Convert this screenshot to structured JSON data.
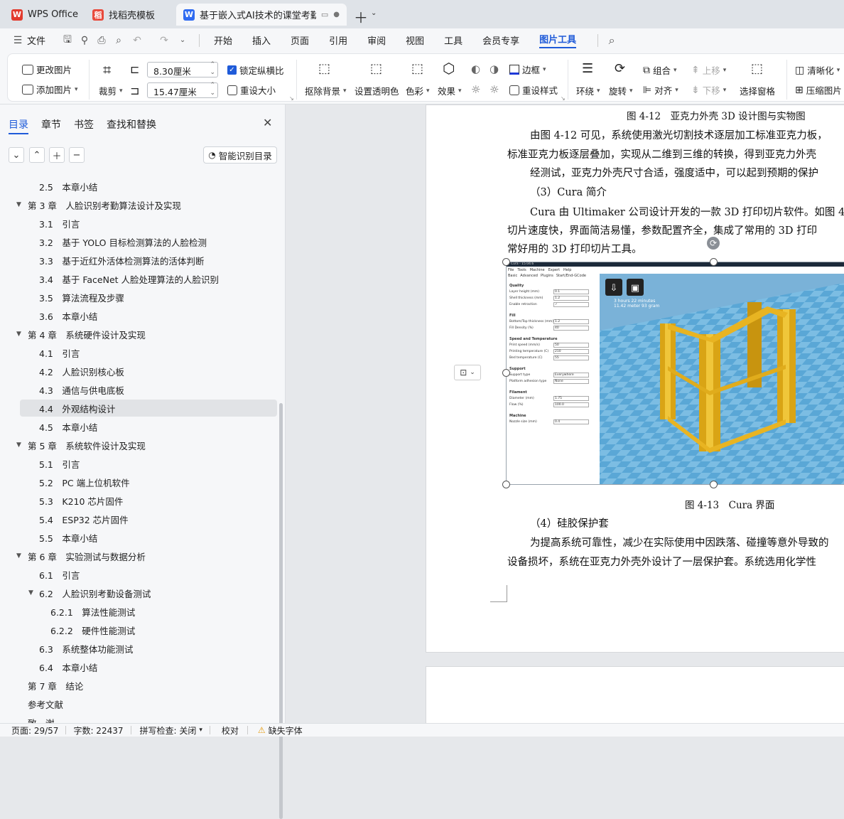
{
  "tabs": [
    {
      "label": "WPS Office",
      "icon": "wps-logo"
    },
    {
      "label": "找稻壳模板",
      "icon": "docer-logo"
    },
    {
      "label": "基于嵌入式AI技术的课堂考勤系",
      "icon": "word-doc-logo"
    }
  ],
  "menu": {
    "file": "文件",
    "items": [
      "开始",
      "插入",
      "页面",
      "引用",
      "审阅",
      "视图",
      "工具",
      "会员专享",
      "图片工具"
    ],
    "active": "图片工具"
  },
  "ribbon": {
    "change_image": "更改图片",
    "add_image": "添加图片",
    "crop": "裁剪",
    "width": "8.30厘米",
    "height": "15.47厘米",
    "lock_ratio": "锁定纵横比",
    "resize": "重设大小",
    "remove_bg": "抠除背景",
    "set_transparent": "设置透明色",
    "color": "色彩",
    "effect": "效果",
    "border": "边框",
    "reset_style": "重设样式",
    "wrap": "环绕",
    "rotate": "旋转",
    "group": "组合",
    "align": "对齐",
    "move_up": "上移",
    "move_down": "下移",
    "select_pane": "选择窗格",
    "sharpen": "清晰化",
    "compress": "压缩图片"
  },
  "nav": {
    "tabs": [
      "目录",
      "章节",
      "书签",
      "查找和替换"
    ],
    "smart_toc": "智能识别目录",
    "items": [
      {
        "label": "2.5　本章小结",
        "level": 2
      },
      {
        "label": "第 3 章　人脸识别考勤算法设计及实现",
        "level": 1
      },
      {
        "label": "3.1　引言",
        "level": 2
      },
      {
        "label": "3.2　基于 YOLO 目标检测算法的人脸检测",
        "level": 2
      },
      {
        "label": "3.3　基于近红外活体检测算法的活体判断",
        "level": 2
      },
      {
        "label": "3.4　基于 FaceNet 人脸处理算法的人脸识别",
        "level": 2
      },
      {
        "label": "3.5　算法流程及步骤",
        "level": 2
      },
      {
        "label": "3.6　本章小结",
        "level": 2
      },
      {
        "label": "第 4 章　系统硬件设计及实现",
        "level": 1
      },
      {
        "label": "4.1　引言",
        "level": 2
      },
      {
        "label": "4.2　人脸识别核心板",
        "level": 2
      },
      {
        "label": "4.3　通信与供电底板",
        "level": 2
      },
      {
        "label": "4.4　外观结构设计",
        "level": 2
      },
      {
        "label": "4.5　本章小结",
        "level": 2
      },
      {
        "label": "第 5 章　系统软件设计及实现",
        "level": 1
      },
      {
        "label": "5.1　引言",
        "level": 2
      },
      {
        "label": "5.2　PC 端上位机软件",
        "level": 2
      },
      {
        "label": "5.3　K210 芯片固件",
        "level": 2
      },
      {
        "label": "5.4　ESP32 芯片固件",
        "level": 2
      },
      {
        "label": "5.5　本章小结",
        "level": 2
      },
      {
        "label": "第 6 章　实验测试与数据分析",
        "level": 1
      },
      {
        "label": "6.1　引言",
        "level": 2
      },
      {
        "label": "6.2　人脸识别考勤设备测试",
        "level": 2
      },
      {
        "label": "6.2.1　算法性能测试",
        "level": 3
      },
      {
        "label": "6.2.2　硬件性能测试",
        "level": 3
      },
      {
        "label": "6.3　系统整体功能测试",
        "level": 2
      },
      {
        "label": "6.4　本章小结",
        "level": 2
      },
      {
        "label": "第 7 章　结论",
        "level": 1
      },
      {
        "label": "参考文献",
        "level": 1
      },
      {
        "label": "致　谢",
        "level": 1
      }
    ]
  },
  "doc": {
    "caption_top": "图 4-12　亚克力外壳 3D 设计图与实物图",
    "p1": "由图 4-12 可见，系统使用激光切割技术逐层加工标准亚克力板，",
    "p1b": "标准亚克力板逐层叠加，实现从二维到三维的转换，得到亚克力外壳",
    "p2": "经测试，亚克力外壳尺寸合适，强度适中，可以起到预期的保护",
    "h3": "（3）Cura 简介",
    "p3": "Cura 由 Ultimaker 公司设计开发的一款 3D 打印切片软件。如图 4",
    "p3b": "切片速度快，界面简洁易懂，参数配置齐全，集成了常用的 3D 打印",
    "p3c": "常好用的 3D 打印切片工具。",
    "caption_fig": "图 4-13　Cura 界面",
    "h4": "（4）硅胶保护套",
    "p4": "为提高系统可靠性，减少在实际使用中因跌落、碰撞等意外导致的",
    "p4b": "设备损坏，系统在亚克力外壳外设计了一层保护套。系统选用化学性"
  },
  "cura": {
    "title": "Cura - 15.04.6",
    "menu": [
      "File",
      "Tools",
      "Machine",
      "Expert",
      "Help"
    ],
    "tabs": [
      "Basic",
      "Advanced",
      "Plugins",
      "Start/End-GCode"
    ],
    "sections": [
      {
        "title": "Quality",
        "rows": [
          {
            "k": "Layer height (mm)",
            "v": "0.1"
          },
          {
            "k": "Shell thickness (mm)",
            "v": "1.2"
          },
          {
            "k": "Enable retraction",
            "v": "✓"
          }
        ]
      },
      {
        "title": "Fill",
        "rows": [
          {
            "k": "Bottom/Top thickness (mm)",
            "v": "1.2"
          },
          {
            "k": "Fill Density (%)",
            "v": "40"
          }
        ]
      },
      {
        "title": "Speed and Temperature",
        "rows": [
          {
            "k": "Print speed (mm/s)",
            "v": "50"
          },
          {
            "k": "Printing temperature (C)",
            "v": "210"
          },
          {
            "k": "Bed temperature (C)",
            "v": "55"
          }
        ]
      },
      {
        "title": "Support",
        "rows": [
          {
            "k": "Support type",
            "v": "Everywhere"
          },
          {
            "k": "Platform adhesion type",
            "v": "None"
          }
        ]
      },
      {
        "title": "Filament",
        "rows": [
          {
            "k": "Diameter (mm)",
            "v": "1.75"
          },
          {
            "k": "Flow (%)",
            "v": "100.0"
          }
        ]
      },
      {
        "title": "Machine",
        "rows": [
          {
            "k": "Nozzle size (mm)",
            "v": "0.4"
          }
        ]
      }
    ],
    "print_info": "3 hours 22 minutes",
    "print_info2": "11.42 meter 93 gram"
  },
  "status": {
    "page": "页面: 29/57",
    "words": "字数: 22437",
    "spell": "拼写检查: 关闭",
    "proof": "校对",
    "missing_font": "缺失字体"
  },
  "colors": {
    "accent": "#1f5bd9",
    "cura_floor": "#5aa7d6",
    "cura_model": "#e8b422"
  }
}
